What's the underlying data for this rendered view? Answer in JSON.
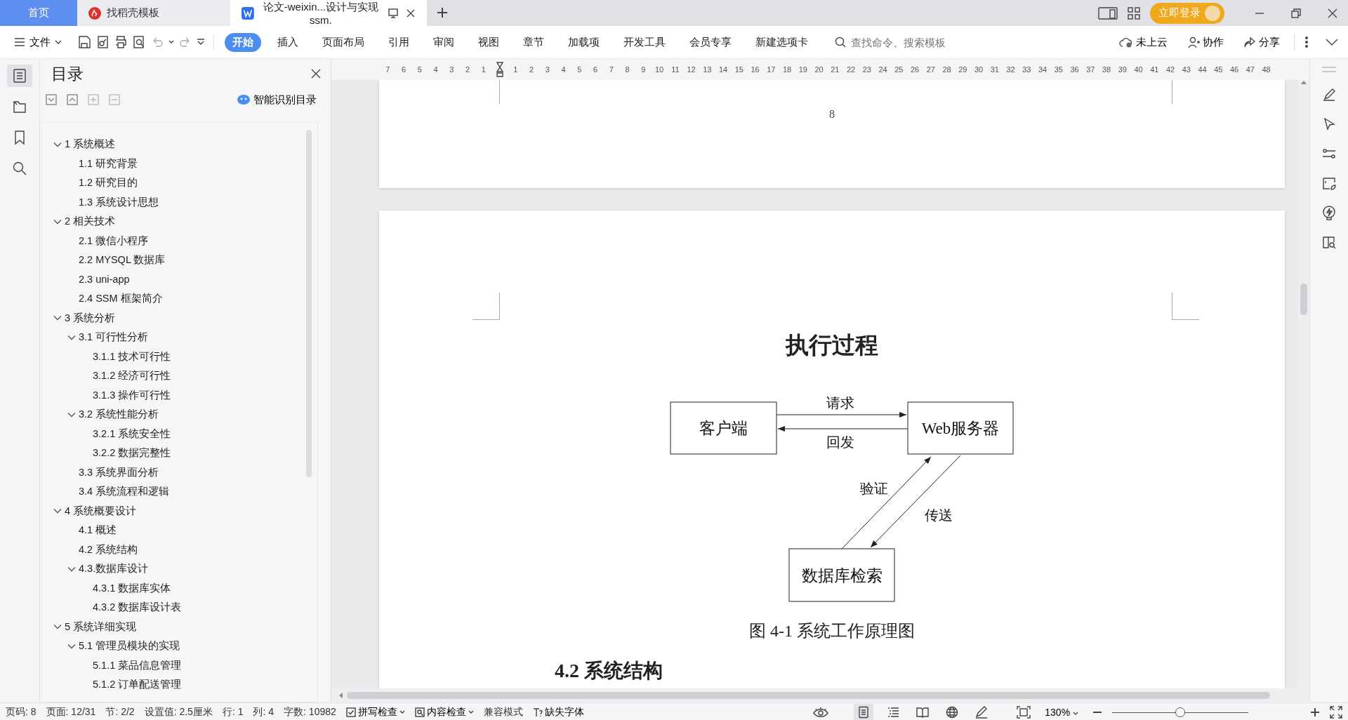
{
  "tabs": [
    {
      "label": "首页",
      "kind": "home",
      "selected": false
    },
    {
      "label": "找稻壳模板",
      "kind": "template",
      "selected": false
    },
    {
      "label": "论文-weixin...设计与实现ssm.",
      "kind": "document",
      "selected": true
    }
  ],
  "login_button": "立即登录",
  "toolbar": {
    "file_menu": "文件",
    "ribbon_tabs": [
      {
        "label": "开始",
        "selected": true
      },
      {
        "label": "插入",
        "selected": false
      },
      {
        "label": "页面布局",
        "selected": false
      },
      {
        "label": "引用",
        "selected": false
      },
      {
        "label": "审阅",
        "selected": false
      },
      {
        "label": "视图",
        "selected": false
      },
      {
        "label": "章节",
        "selected": false
      },
      {
        "label": "加载项",
        "selected": false
      },
      {
        "label": "开发工具",
        "selected": false
      },
      {
        "label": "会员专享",
        "selected": false
      },
      {
        "label": "新建选项卡",
        "selected": false
      }
    ],
    "search": {
      "placeholder": "查找命令、搜索模板"
    },
    "actions": [
      "未上云",
      "协作",
      "分享"
    ]
  },
  "ruler": {
    "left_numbers": [
      "7",
      "6",
      "5",
      "4",
      "3",
      "2",
      "1"
    ],
    "right_numbers": [
      "1",
      "2",
      "3",
      "4",
      "5",
      "6",
      "7",
      "8",
      "9",
      "10",
      "11",
      "12",
      "13",
      "14",
      "15",
      "16",
      "17",
      "18",
      "19",
      "20",
      "21",
      "22",
      "23",
      "24",
      "25",
      "26",
      "27",
      "28",
      "29",
      "30",
      "31",
      "32",
      "33",
      "34",
      "35",
      "36",
      "37",
      "38",
      "39",
      "40",
      "41",
      "42",
      "43",
      "44",
      "45",
      "46",
      "47",
      "48"
    ]
  },
  "left_rail": [
    {
      "kind": "toc",
      "selected": true
    },
    {
      "kind": "navigation",
      "selected": false
    },
    {
      "kind": "bookmark",
      "selected": false
    },
    {
      "kind": "search",
      "selected": false
    }
  ],
  "toc_panel": {
    "title": "目录",
    "smart_button": "智能识别目录",
    "items": [
      {
        "label": "1 系统概述",
        "expanded": true,
        "children": [
          {
            "label": "1.1  研究背景"
          },
          {
            "label": "1.2 研究目的"
          },
          {
            "label": "1.3 系统设计思想"
          }
        ]
      },
      {
        "label": "2 相关技术",
        "expanded": true,
        "children": [
          {
            "label": "2.1 微信小程序"
          },
          {
            "label": "2.2 MYSQL 数据库"
          },
          {
            "label": "2.3 uni-app"
          },
          {
            "label": "2.4 SSM 框架简介"
          }
        ]
      },
      {
        "label": "3 系统分析",
        "expanded": true,
        "children": [
          {
            "label": "3.1 可行性分析",
            "expanded": true,
            "children": [
              {
                "label": "3.1.1 技术可行性"
              },
              {
                "label": "3.1.2 经济可行性"
              },
              {
                "label": "3.1.3 操作可行性"
              }
            ]
          },
          {
            "label": "3.2 系统性能分析",
            "expanded": true,
            "children": [
              {
                "label": "3.2.1  系统安全性"
              },
              {
                "label": "3.2.2  数据完整性"
              }
            ]
          },
          {
            "label": "3.3 系统界面分析"
          },
          {
            "label": "3.4 系统流程和逻辑"
          }
        ]
      },
      {
        "label": "4 系统概要设计",
        "expanded": true,
        "children": [
          {
            "label": "4.1 概述"
          },
          {
            "label": "4.2 系统结构"
          },
          {
            "label": "4.3.数据库设计",
            "expanded": true,
            "children": [
              {
                "label": "4.3.1 数据库实体"
              },
              {
                "label": "4.3.2 数据库设计表"
              }
            ]
          }
        ]
      },
      {
        "label": "5 系统详细实现",
        "expanded": true,
        "children": [
          {
            "label": "5.1  管理员模块的实现",
            "expanded": true,
            "children": [
              {
                "label": "5.1.1  菜品信息管理"
              },
              {
                "label": "5.1.2  订单配送管理"
              }
            ]
          }
        ]
      }
    ]
  },
  "document": {
    "page_number": "8",
    "diagram": {
      "title": "执行过程",
      "nodes": [
        {
          "label": "客户端"
        },
        {
          "label": "Web服务器"
        },
        {
          "label": "数据库检索"
        }
      ],
      "arrows": [
        {
          "label": "请求"
        },
        {
          "label": "回发"
        },
        {
          "label": "验证"
        },
        {
          "label": "传送"
        }
      ],
      "caption": "图 4-1 系统工作原理图"
    },
    "next_heading": "4.2 系统结构"
  },
  "status_bar": {
    "items": [
      "页码: 8",
      "页面: 12/31",
      "节: 2/2",
      "设置值: 2.5厘米",
      "行: 1",
      "列: 4",
      "字数: 10982"
    ],
    "checks": [
      {
        "label": "拼写检查",
        "kind": "spell",
        "checked": true
      },
      {
        "label": "内容检查",
        "kind": "content"
      }
    ],
    "compat_mode": "兼容模式",
    "missing_fonts": "缺失字体",
    "view_modes": [
      {
        "kind": "page",
        "selected": true
      },
      {
        "kind": "outline",
        "selected": false
      },
      {
        "kind": "reading",
        "selected": false
      },
      {
        "kind": "web",
        "selected": false
      },
      {
        "kind": "write",
        "selected": false
      }
    ],
    "zoom": "130%",
    "zoom_slider": {
      "level": 0.5
    }
  }
}
